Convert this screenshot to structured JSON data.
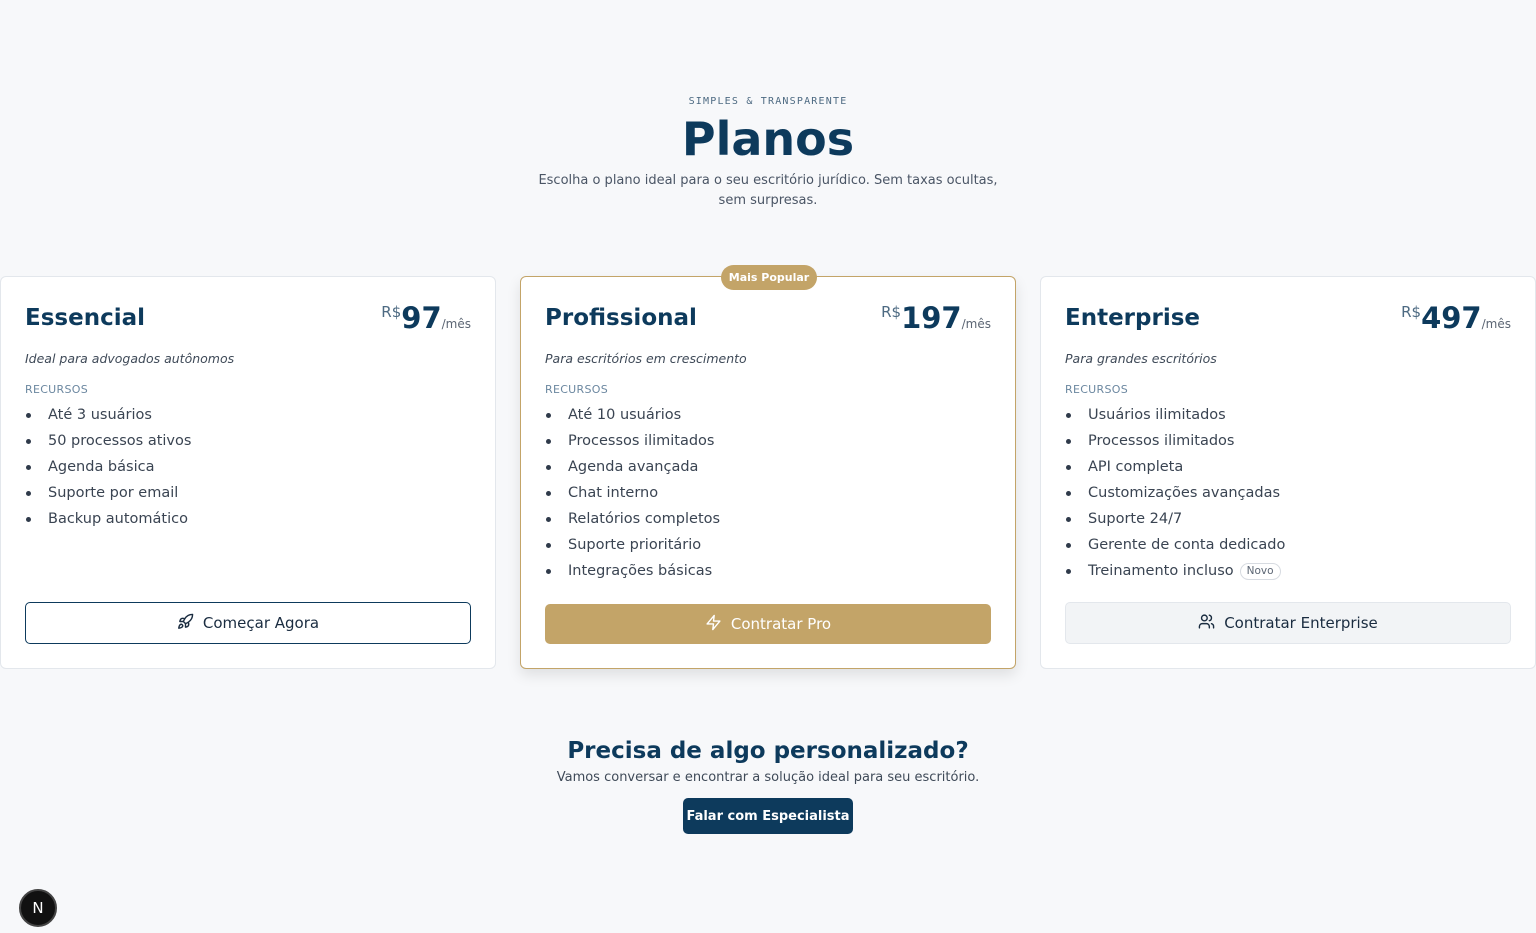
{
  "header": {
    "eyebrow": "SIMPLES & TRANSPARENTE",
    "title": "Planos",
    "subtitle": "Escolha o plano ideal para o seu escritório jurídico. Sem taxas ocultas, sem surpresas."
  },
  "plans": [
    {
      "name": "Essencial",
      "currency": "R$",
      "amount": "97",
      "period": "/mês",
      "description": "Ideal para advogados autônomos",
      "features_label": "RECURSOS",
      "features": [
        "Até 3 usuários",
        "50 processos ativos",
        "Agenda básica",
        "Suporte por email",
        "Backup automático"
      ],
      "button_label": "Começar Agora",
      "button_icon": "rocket-icon"
    },
    {
      "badge": "Mais Popular",
      "name": "Profissional",
      "currency": "R$",
      "amount": "197",
      "period": "/mês",
      "description": "Para escritórios em crescimento",
      "features_label": "RECURSOS",
      "features": [
        "Até 10 usuários",
        "Processos ilimitados",
        "Agenda avançada",
        "Chat interno",
        "Relatórios completos",
        "Suporte prioritário",
        "Integrações básicas"
      ],
      "button_label": "Contratar Pro",
      "button_icon": "lightning-icon"
    },
    {
      "name": "Enterprise",
      "currency": "R$",
      "amount": "497",
      "period": "/mês",
      "description": "Para grandes escritórios",
      "features_label": "RECURSOS",
      "features": [
        "Usuários ilimitados",
        "Processos ilimitados",
        "API completa",
        "Customizações avançadas",
        "Suporte 24/7",
        "Gerente de conta dedicado",
        "Treinamento incluso"
      ],
      "new_tag": "Novo",
      "button_label": "Contratar Enterprise",
      "button_icon": "users-icon"
    }
  ],
  "cta": {
    "title": "Precisa de algo personalizado?",
    "subtitle": "Vamos conversar e encontrar a solução ideal para seu escritório.",
    "button_label": "Falar com Especialista"
  },
  "dev_badge": "N",
  "colors": {
    "brand_navy": "#0d3a5c",
    "accent_gold": "#c3a468",
    "background": "#f7f8fa"
  }
}
